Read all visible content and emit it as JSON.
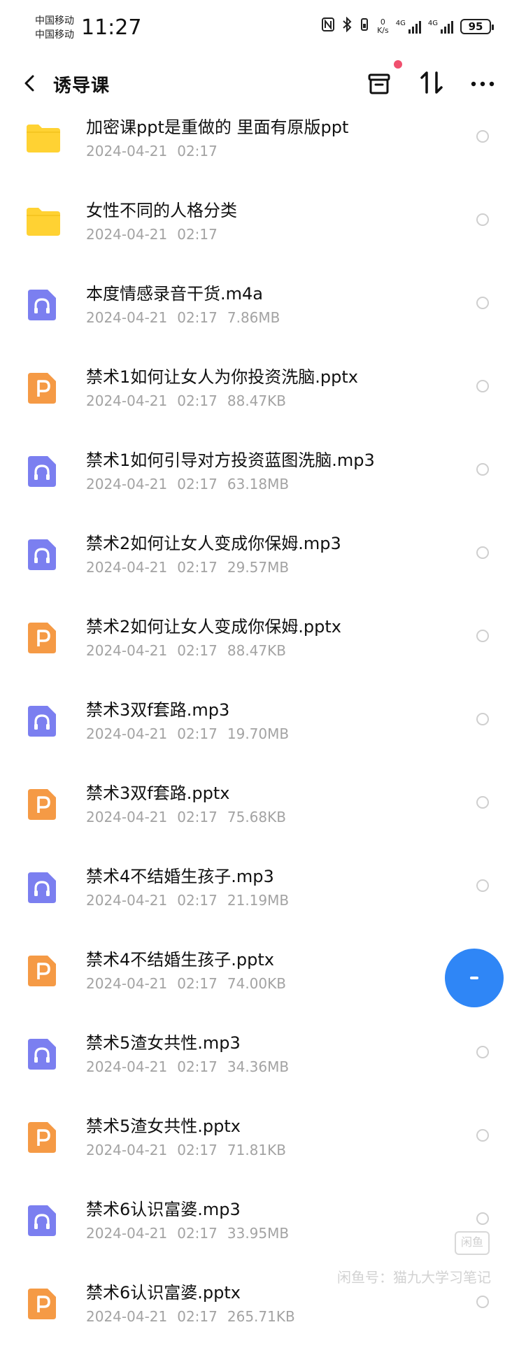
{
  "status_bar": {
    "carrier_1": "中国移动",
    "carrier_2": "中国移动",
    "time": "11:27",
    "net_speed_value": "0",
    "net_speed_unit": "K/s",
    "signal_1_label": "4G",
    "signal_2_label": "4G",
    "battery": "95"
  },
  "header": {
    "title": "诱导课"
  },
  "files": [
    {
      "name": "加密课ppt是重做的 里面有原版ppt",
      "date": "2024-04-21",
      "time": "02:17",
      "size": "",
      "type": "folder"
    },
    {
      "name": "女性不同的人格分类",
      "date": "2024-04-21",
      "time": "02:17",
      "size": "",
      "type": "folder"
    },
    {
      "name": "本度情感录音干货.m4a",
      "date": "2024-04-21",
      "time": "02:17",
      "size": "7.86MB",
      "type": "audio"
    },
    {
      "name": "禁术1如何让女人为你投资洗脑.pptx",
      "date": "2024-04-21",
      "time": "02:17",
      "size": "88.47KB",
      "type": "ppt"
    },
    {
      "name": "禁术1如何引导对方投资蓝图洗脑.mp3",
      "date": "2024-04-21",
      "time": "02:17",
      "size": "63.18MB",
      "type": "audio"
    },
    {
      "name": "禁术2如何让女人变成你保姆.mp3",
      "date": "2024-04-21",
      "time": "02:17",
      "size": "29.57MB",
      "type": "audio"
    },
    {
      "name": "禁术2如何让女人变成你保姆.pptx",
      "date": "2024-04-21",
      "time": "02:17",
      "size": "88.47KB",
      "type": "ppt"
    },
    {
      "name": "禁术3双f套路.mp3",
      "date": "2024-04-21",
      "time": "02:17",
      "size": "19.70MB",
      "type": "audio"
    },
    {
      "name": "禁术3双f套路.pptx",
      "date": "2024-04-21",
      "time": "02:17",
      "size": "75.68KB",
      "type": "ppt"
    },
    {
      "name": "禁术4不结婚生孩子.mp3",
      "date": "2024-04-21",
      "time": "02:17",
      "size": "21.19MB",
      "type": "audio"
    },
    {
      "name": "禁术4不结婚生孩子.pptx",
      "date": "2024-04-21",
      "time": "02:17",
      "size": "74.00KB",
      "type": "ppt"
    },
    {
      "name": "禁术5渣女共性.mp3",
      "date": "2024-04-21",
      "time": "02:17",
      "size": "34.36MB",
      "type": "audio"
    },
    {
      "name": "禁术5渣女共性.pptx",
      "date": "2024-04-21",
      "time": "02:17",
      "size": "71.81KB",
      "type": "ppt"
    },
    {
      "name": "禁术6认识富婆.mp3",
      "date": "2024-04-21",
      "time": "02:17",
      "size": "33.95MB",
      "type": "audio"
    },
    {
      "name": "禁术6认识富婆.pptx",
      "date": "2024-04-21",
      "time": "02:17",
      "size": "265.71KB",
      "type": "ppt"
    }
  ],
  "icons": {
    "folder": "folder-icon",
    "audio": "audio-file-icon",
    "ppt": "ppt-file-icon"
  },
  "colors": {
    "folder": "#ffd233",
    "audio": "#7b7ff0",
    "ppt": "#f59a45",
    "fab": "#2f86f6",
    "badge": "#f0506e",
    "meta_text": "#a3a3a3"
  },
  "watermark": {
    "badge": "闲鱼",
    "text": "闲鱼号：猫九大学习笔记"
  }
}
